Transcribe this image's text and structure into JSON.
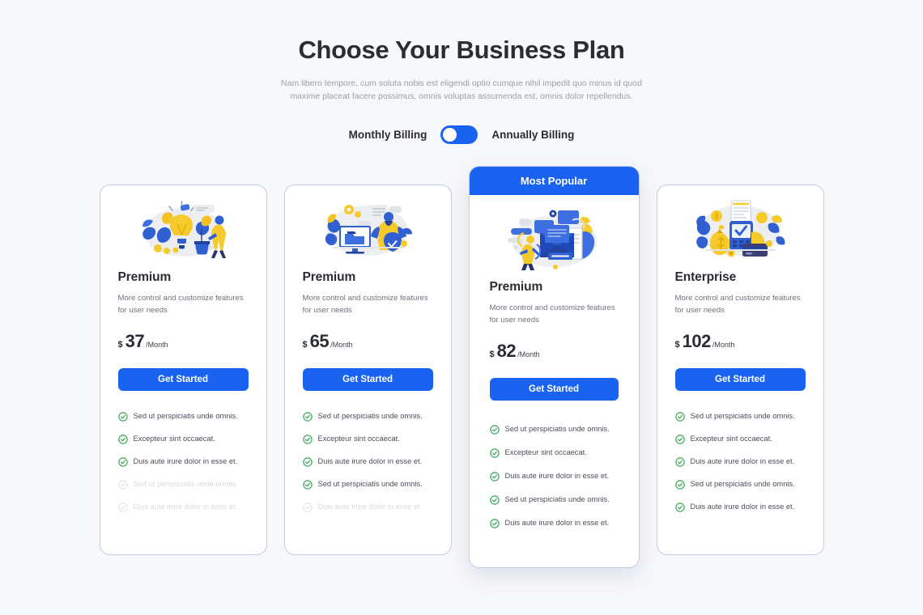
{
  "hero": {
    "title": "Choose Your Business Plan",
    "subtitle": "Nam libero tempore, cum soluta nobis est eligendi optio cumque nihil impedit quo minus id quod maxime placeat facere possimus, omnis voluptas assumenda est, omnis dolor repellendus."
  },
  "billing": {
    "monthly_label": "Monthly Billing",
    "annually_label": "Annually Billing",
    "selected": "Monthly Billing",
    "toggle_state": "left",
    "accent_color": "#1a62f0"
  },
  "plans": [
    {
      "name": "Premium",
      "description": "More control and customize features for user needs",
      "currency": "$",
      "amount": "37",
      "period": "/Month",
      "cta_label": "Get Started",
      "featured": false,
      "badge": "",
      "illustration": "lightbulb-idea-illustration",
      "features": [
        {
          "text": "Sed ut perspiciatis unde omnis.",
          "enabled": true
        },
        {
          "text": "Excepteur sint occaecat.",
          "enabled": true
        },
        {
          "text": "Duis aute irure dolor in esse et.",
          "enabled": true
        },
        {
          "text": "Sed ut perspiciatis unde omnis.",
          "enabled": false
        },
        {
          "text": "Duis aute irure dolor in esse et.",
          "enabled": false
        }
      ]
    },
    {
      "name": "Premium",
      "description": "More control and customize features for user needs",
      "currency": "$",
      "amount": "65",
      "period": "/Month",
      "cta_label": "Get Started",
      "featured": false,
      "badge": "",
      "illustration": "desktop-folder-illustration",
      "features": [
        {
          "text": "Sed ut perspiciatis unde omnis.",
          "enabled": true
        },
        {
          "text": "Excepteur sint occaecat.",
          "enabled": true
        },
        {
          "text": "Duis aute irure dolor in esse et.",
          "enabled": true
        },
        {
          "text": "Sed ut perspiciatis unde omnis.",
          "enabled": true
        },
        {
          "text": "Duis aute irure dolor in esse et.",
          "enabled": false
        }
      ]
    },
    {
      "name": "Premium",
      "description": "More control and customize features for user needs",
      "currency": "$",
      "amount": "82",
      "period": "/Month",
      "cta_label": "Get Started",
      "featured": true,
      "badge": "Most Popular",
      "illustration": "email-envelope-illustration",
      "features": [
        {
          "text": "Sed ut perspiciatis unde omnis.",
          "enabled": true
        },
        {
          "text": "Excepteur sint occaecat.",
          "enabled": true
        },
        {
          "text": "Duis aute irure dolor in esse et.",
          "enabled": true
        },
        {
          "text": "Sed ut perspiciatis unde omnis.",
          "enabled": true
        },
        {
          "text": "Duis aute irure dolor in esse et.",
          "enabled": true
        }
      ]
    },
    {
      "name": "Enterprise",
      "description": "More control and customize features for user needs",
      "currency": "$",
      "amount": "102",
      "period": "/Month",
      "cta_label": "Get Started",
      "featured": false,
      "badge": "",
      "illustration": "payment-terminal-illustration",
      "features": [
        {
          "text": "Sed ut perspiciatis unde omnis.",
          "enabled": true
        },
        {
          "text": "Excepteur sint occaecat.",
          "enabled": true
        },
        {
          "text": "Duis aute irure dolor in esse et.",
          "enabled": true
        },
        {
          "text": "Sed ut perspiciatis unde omnis.",
          "enabled": true
        },
        {
          "text": "Duis aute irure dolor in esse et.",
          "enabled": true
        }
      ]
    }
  ]
}
